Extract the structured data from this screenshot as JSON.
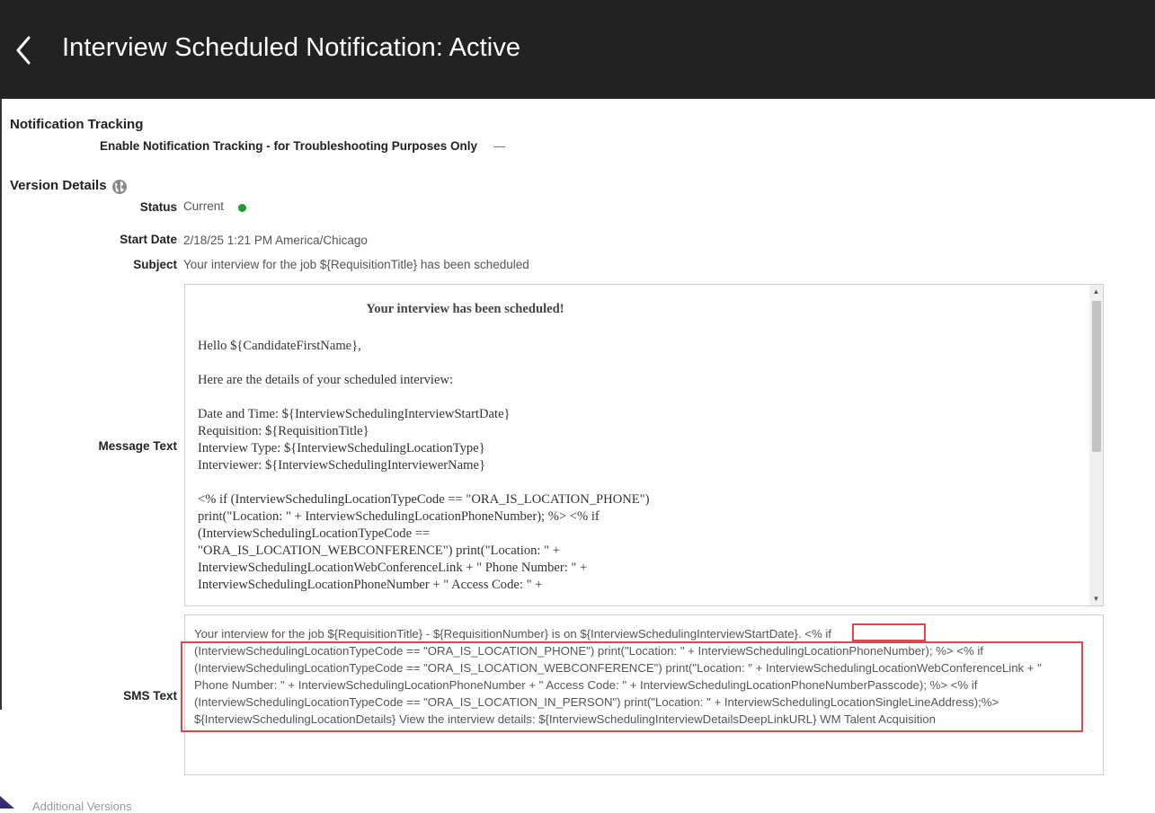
{
  "header": {
    "title": "Interview Scheduled Notification: Active",
    "back_label": "Back"
  },
  "notification_tracking": {
    "title": "Notification Tracking",
    "label": "Enable Notification Tracking - for Troubleshooting Purposes Only",
    "value": "—"
  },
  "version_details": {
    "title": "Version Details",
    "status_label": "Status",
    "status_value": "Current",
    "status_color": "#1c9a2e",
    "start_date_label": "Start Date",
    "start_date_value": "2/18/25 1:21 PM America/Chicago",
    "subject_label": "Subject",
    "subject_value": "Your interview for the job ${RequisitionTitle} has been scheduled",
    "message_label": "Message Text",
    "sms_label": "SMS Text"
  },
  "message": {
    "heading": "Your interview has been scheduled!",
    "lines": [
      "Hello ${CandidateFirstName},",
      "",
      "Here are the details of your scheduled interview:",
      "",
      "Date and Time: ${InterviewSchedulingInterviewStartDate}",
      "Requisition: ${RequisitionTitle}",
      "Interview Type: ${InterviewSchedulingLocationType}",
      "Interviewer: ${InterviewSchedulingInterviewerName}",
      "",
      "<% if (InterviewSchedulingLocationTypeCode == \"ORA_IS_LOCATION_PHONE\")",
      "print(\"Location: \" + InterviewSchedulingLocationPhoneNumber); %> <% if",
      "(InterviewSchedulingLocationTypeCode ==",
      "\"ORA_IS_LOCATION_WEBCONFERENCE\") print(\"Location: \" +",
      "InterviewSchedulingLocationWebConferenceLink + \" Phone Number: \" +",
      "InterviewSchedulingLocationPhoneNumber + \" Access Code: \" +"
    ]
  },
  "sms": {
    "lines": [
      "Your interview for the job ${RequisitionTitle} - ${RequisitionNumber} is on ${InterviewSchedulingInterviewStartDate}. <% if",
      "(InterviewSchedulingLocationTypeCode == \"ORA_IS_LOCATION_PHONE\") print(\"Location: \" + InterviewSchedulingLocationPhoneNumber); %> <% if",
      "(InterviewSchedulingLocationTypeCode == \"ORA_IS_LOCATION_WEBCONFERENCE\") print(\"Location: \" + InterviewSchedulingLocationWebConferenceLink + \"",
      "Phone Number: \" + InterviewSchedulingLocationPhoneNumber + \" Access Code: \" + InterviewSchedulingLocationPhoneNumberPasscode); %> <% if",
      "(InterviewSchedulingLocationTypeCode == \"ORA_IS_LOCATION_IN_PERSON\") print(\"Location: \" + InterviewSchedulingLocationSingleLineAddress);%>",
      "${InterviewSchedulingLocationDetails} View the interview details: ${InterviewSchedulingInterviewDetailsDeepLinkURL} WM Talent Acquisition"
    ]
  },
  "footer": {
    "partial_text": "Additional Versions"
  },
  "colors": {
    "header_bg": "#222222",
    "highlight": "#e0474c",
    "status_dot": "#1c9a2e"
  }
}
